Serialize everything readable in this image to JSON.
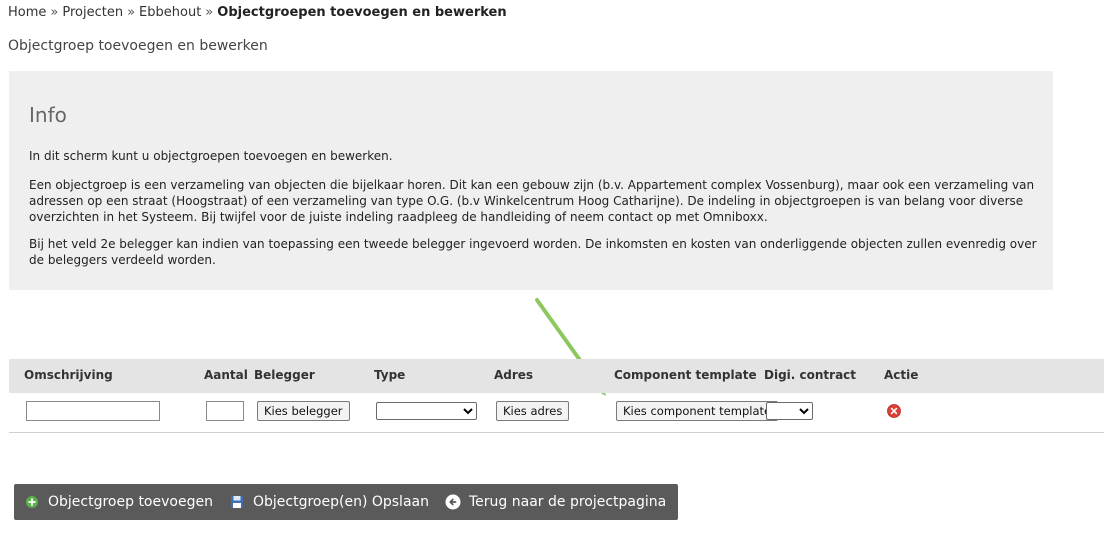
{
  "breadcrumb": {
    "items": [
      "Home",
      "Projecten",
      "Ebbehout"
    ],
    "separator": "»",
    "current": "Objectgroepen toevoegen en bewerken"
  },
  "page_title": "Objectgroep toevoegen en bewerken",
  "info": {
    "title": "Info",
    "paragraphs": [
      "In dit scherm kunt u objectgroepen toevoegen en bewerken.",
      "Een objectgroep is een verzameling van objecten die bijelkaar horen. Dit kan een gebouw zijn (b.v. Appartement complex Vossenburg), maar ook een verzameling van adressen op een straat (Hoogstraat) of een verzameling van type O.G. (b.v Winkelcentrum Hoog Catharijne). De indeling in objectgroepen is van belang voor diverse overzichten in het Systeem. Bij twijfel voor de juiste indeling raadpleeg de handleiding of neem contact op met Omniboxx.",
      "Bij het veld 2e belegger kan indien van toepassing een tweede belegger ingevoerd worden. De inkomsten en kosten van onderliggende objecten zullen evenredig over de beleggers verdeeld worden."
    ]
  },
  "table": {
    "headers": {
      "omschrijving": "Omschrijving",
      "aantal": "Aantal",
      "belegger": "Belegger",
      "type": "Type",
      "adres": "Adres",
      "component_template": "Component template",
      "digi_contract": "Digi. contract",
      "actie": "Actie"
    },
    "row": {
      "omschrijving_value": "",
      "aantal_value": "",
      "belegger_button": "Kies belegger",
      "type_selected": "",
      "adres_button": "Kies adres",
      "component_template_button": "Kies component template",
      "digi_contract_selected": "",
      "actie_icon": "delete-icon"
    }
  },
  "actions": {
    "add_label": "Objectgroep toevoegen",
    "save_label": "Objectgroep(en) Opslaan",
    "back_label": "Terug naar de projectpagina"
  },
  "colors": {
    "info_background": "#efefef",
    "table_header_background": "#e4e4e4",
    "action_button_background": "#5a5a5a",
    "annotation_arrow": "#8dc85f",
    "delete_icon": "#d9413a",
    "add_icon": "#5bb04a",
    "save_icon": "#3d6fb5"
  }
}
